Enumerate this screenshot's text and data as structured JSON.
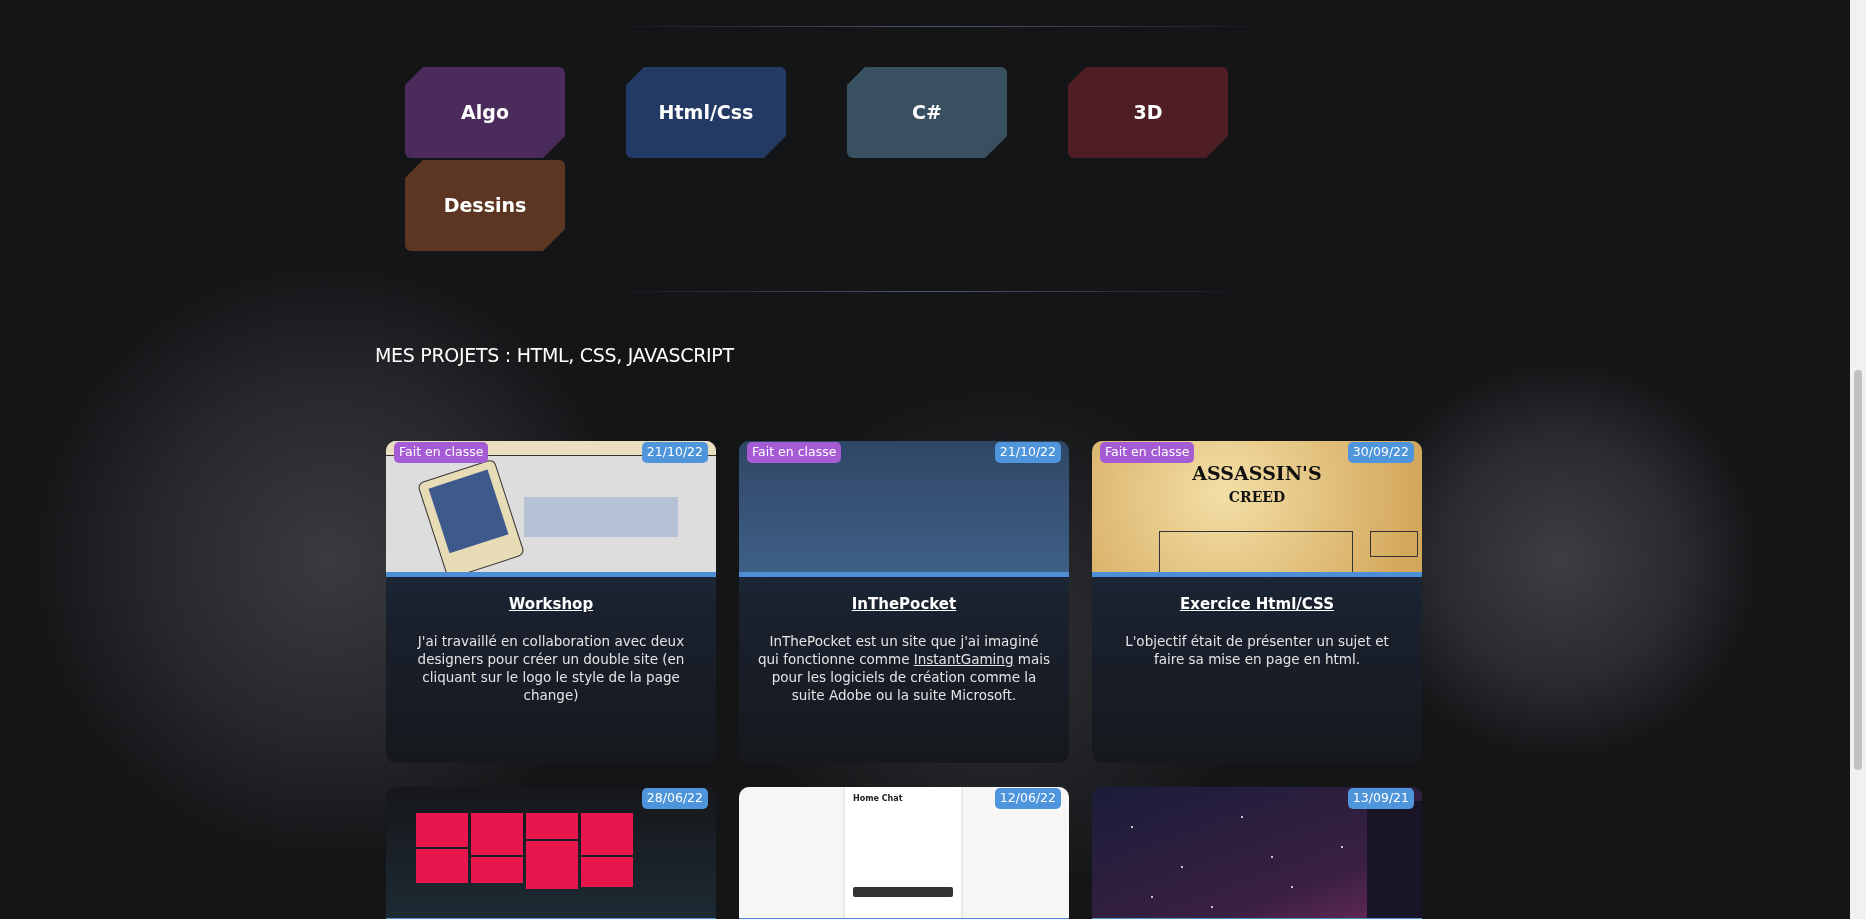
{
  "categories": [
    {
      "label": "Algo",
      "color": "#4a2b5c"
    },
    {
      "label": "Html/Css",
      "color": "#233a64"
    },
    {
      "label": "C#",
      "color": "#38505f"
    },
    {
      "label": "3D",
      "color": "#4f1e24"
    },
    {
      "label": "Dessins",
      "color": "#5c3623"
    }
  ],
  "section_title": "MES PROJETS : HTML, CSS, JAVASCRIPT",
  "projects": [
    {
      "tag": "Fait en classe",
      "date": "21/10/22",
      "title": "Workshop",
      "preview": {
        "kind": "tablet"
      },
      "description": [
        {
          "kind": "text",
          "text": "J'ai travaillé en collaboration avec deux designers pour créer un double site (en cliquant sur le logo le style de la page change)"
        }
      ]
    },
    {
      "tag": "Fait en classe",
      "date": "21/10/22",
      "title": "InThePocket",
      "preview": {
        "kind": "gradient"
      },
      "description": [
        {
          "kind": "text",
          "text": "InThePocket est un site que j'ai imaginé qui fonctionne comme "
        },
        {
          "kind": "link",
          "text": "InstantGaming"
        },
        {
          "kind": "text",
          "text": " mais pour les logiciels de création comme la suite Adobe ou la suite Microsoft."
        }
      ]
    },
    {
      "tag": "Fait en classe",
      "date": "30/09/22",
      "title": "Exercice Html/CSS",
      "preview": {
        "kind": "parchment",
        "heading": "ASSASSIN'S",
        "subheading": "CREED"
      },
      "description": [
        {
          "kind": "text",
          "text": "L'objectif était de présenter un sujet et faire sa mise en page en html."
        }
      ]
    },
    {
      "date": "28/06/22",
      "preview": {
        "kind": "tiles"
      }
    },
    {
      "date": "12/06/22",
      "preview": {
        "kind": "form",
        "heading": "Home Chat"
      }
    },
    {
      "date": "13/09/21",
      "preview": {
        "kind": "starfield"
      }
    }
  ]
}
